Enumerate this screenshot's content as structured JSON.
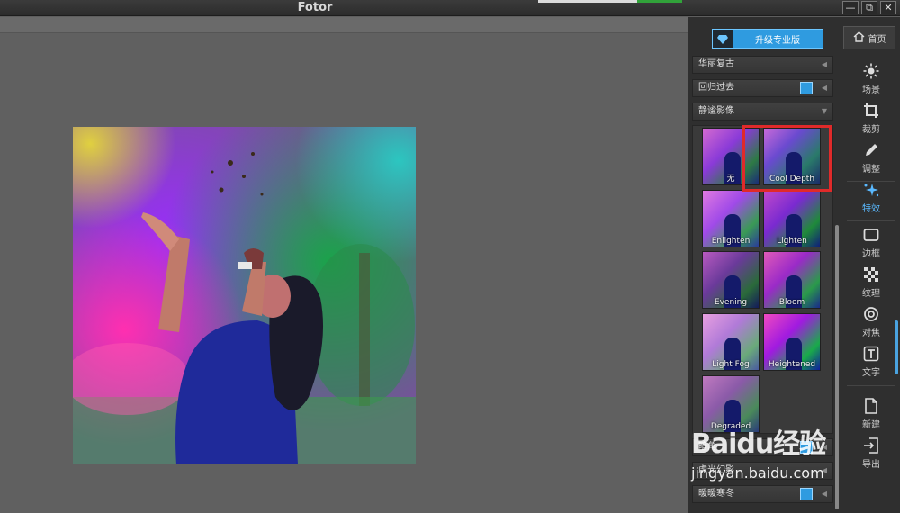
{
  "window": {
    "title": "Fotor",
    "buttons": [
      "—",
      "⧉",
      "✕"
    ]
  },
  "header": {
    "upgrade_label": "升级专业版",
    "home_label": "首页"
  },
  "categories": {
    "top": [
      {
        "label": "华丽复古",
        "pro": false
      },
      {
        "label": "回归过去",
        "pro": true
      },
      {
        "label": "静谧影像",
        "pro": false,
        "expanded": true
      }
    ],
    "bottom": [
      {
        "label": "暗角",
        "pro": true
      },
      {
        "label": "虚光幻影",
        "pro": false
      },
      {
        "label": "暖暖寒冬",
        "pro": true
      }
    ]
  },
  "effects": [
    {
      "label": "无",
      "selected": false
    },
    {
      "label": "Cool Depth",
      "selected": true
    },
    {
      "label": "Enlighten",
      "selected": false
    },
    {
      "label": "Lighten",
      "selected": false
    },
    {
      "label": "Evening",
      "selected": false
    },
    {
      "label": "Bloom",
      "selected": false
    },
    {
      "label": "Light Fog",
      "selected": false
    },
    {
      "label": "Heightened",
      "selected": false
    },
    {
      "label": "Degraded",
      "selected": false
    }
  ],
  "tools": [
    {
      "label": "场景",
      "icon": "sun-icon"
    },
    {
      "label": "裁剪",
      "icon": "crop-icon"
    },
    {
      "label": "调整",
      "icon": "pencil-icon"
    },
    {
      "label": "特效",
      "icon": "sparkle-icon",
      "active": true
    },
    {
      "label": "边框",
      "icon": "frame-icon"
    },
    {
      "label": "纹理",
      "icon": "texture-icon"
    },
    {
      "label": "对焦",
      "icon": "focus-icon"
    },
    {
      "label": "文字",
      "icon": "text-icon"
    },
    {
      "label": "新建",
      "icon": "new-file-icon"
    },
    {
      "label": "导出",
      "icon": "export-icon"
    }
  ],
  "watermark": {
    "brand": "Baidu经验",
    "url": "jingyan.baidu.com"
  },
  "colors": {
    "accent": "#2f9be0",
    "highlight": "#e02a2a",
    "active_tool": "#5ab9ff"
  }
}
